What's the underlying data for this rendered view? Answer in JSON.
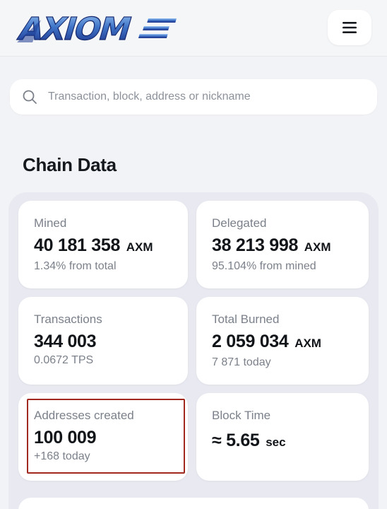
{
  "header": {
    "logo_text": "AXIOME",
    "menu_icon": "hamburger-menu-icon"
  },
  "search": {
    "placeholder": "Transaction, block, address or nickname",
    "value": "",
    "icon": "search-icon"
  },
  "section": {
    "title": "Chain Data"
  },
  "cards": {
    "mined": {
      "label": "Mined",
      "value": "40 181 358",
      "unit": "AXM",
      "sub": "1.34% from total"
    },
    "delegated": {
      "label": "Delegated",
      "value": "38 213 998",
      "unit": "AXM",
      "sub": "95.104% from mined"
    },
    "transactions": {
      "label": "Transactions",
      "value": "344 003",
      "sub": "0.0672 TPS"
    },
    "burned": {
      "label": "Total Burned",
      "value": "2 059 034",
      "unit": "AXM",
      "sub": "7 871 today"
    },
    "addresses": {
      "label": "Addresses created",
      "value": "100 009",
      "sub": "+168 today"
    },
    "block_time": {
      "label": "Block Time",
      "value": "≈ 5.65",
      "unit": "sec"
    }
  },
  "colors": {
    "logo_blue": "#1f3f9c",
    "logo_light": "#6ea7e6",
    "highlight": "#a0281f"
  }
}
